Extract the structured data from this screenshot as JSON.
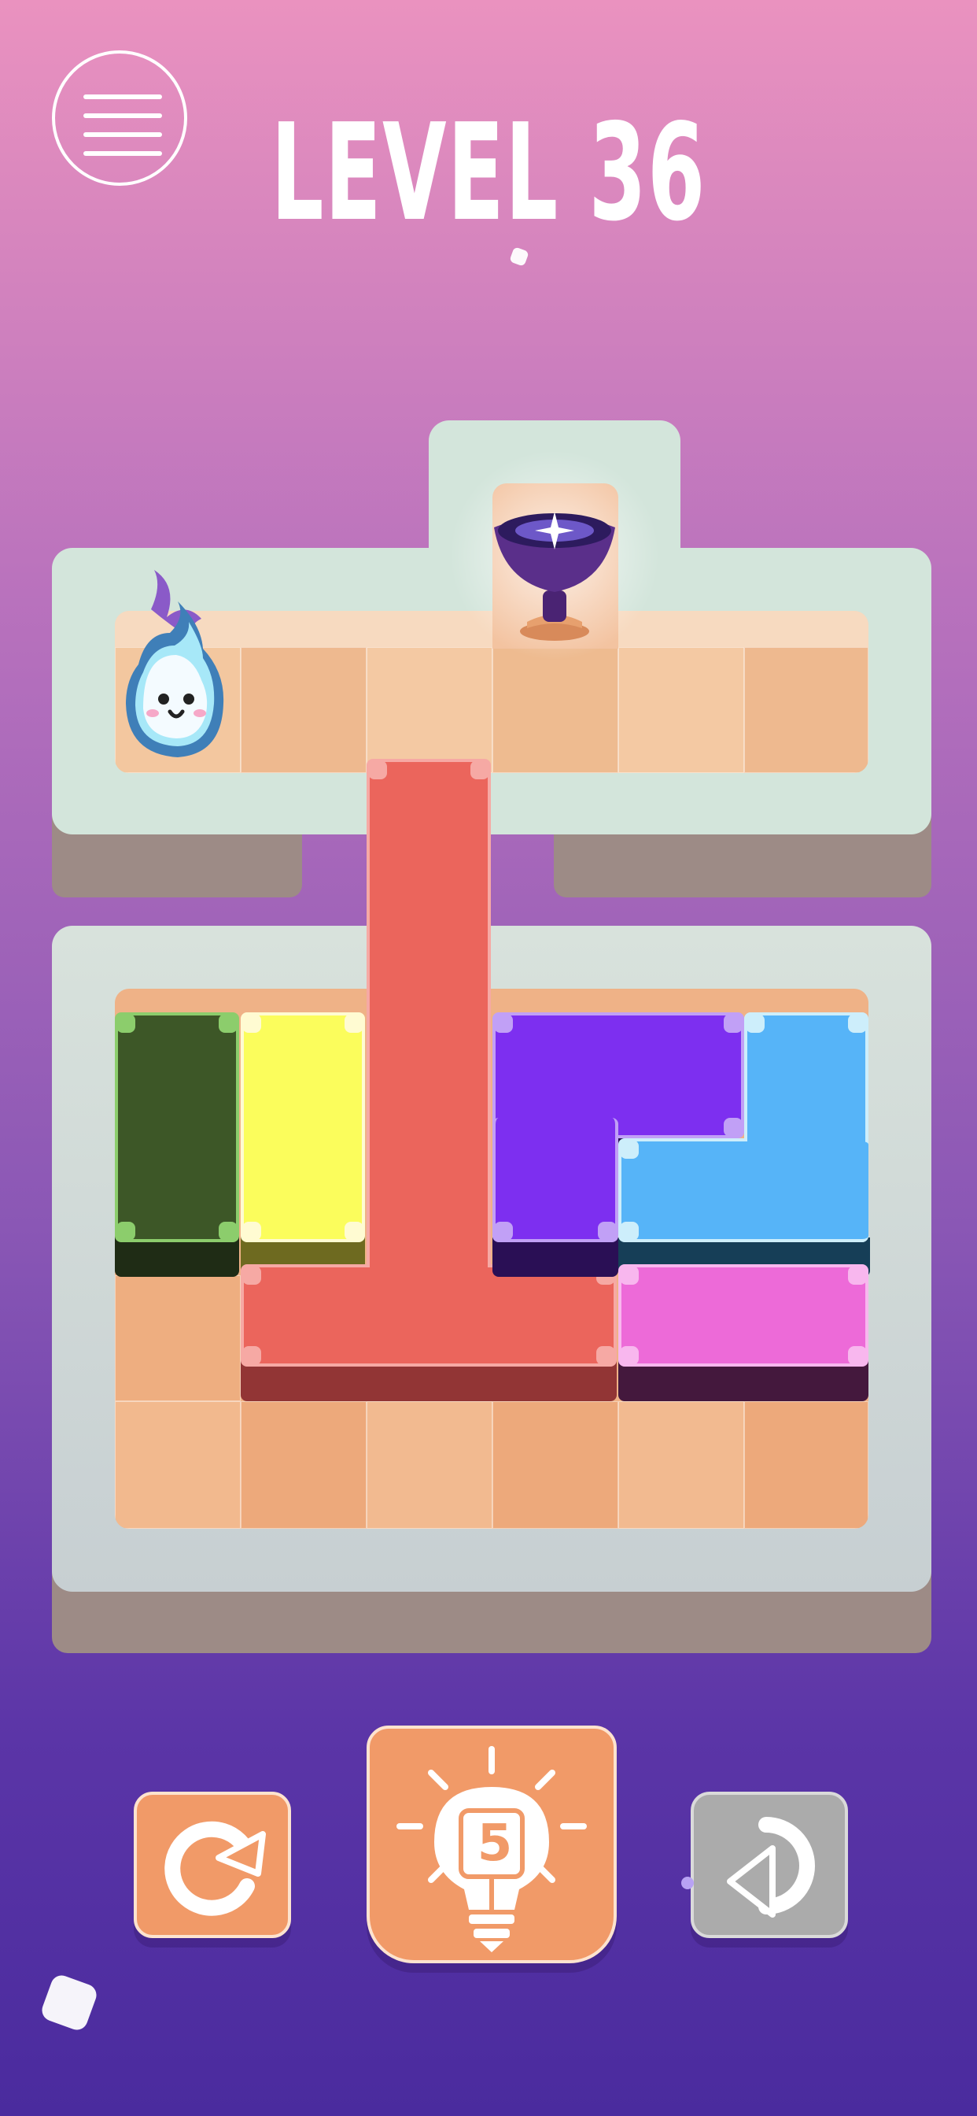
{
  "header": {
    "menu_icon": "hamburger-menu-icon",
    "level_title": "LEVEL 36"
  },
  "board": {
    "rows": 6,
    "cols": 6,
    "player": {
      "name": "fire-spirit",
      "color": "#9ee6f7",
      "flame_color": "#8a5ac8"
    },
    "goal": {
      "name": "purple-goblet",
      "color": "#5a2f8a"
    },
    "blocks": [
      {
        "name": "green-block",
        "color": "#3d5727"
      },
      {
        "name": "yellow-block",
        "color": "#fbfd5c"
      },
      {
        "name": "red-t-block",
        "color": "#eb655c"
      },
      {
        "name": "purple-block",
        "color": "#7d2ff0"
      },
      {
        "name": "blue-block",
        "color": "#56b4f8"
      },
      {
        "name": "pink-block",
        "color": "#ed6ad8"
      }
    ]
  },
  "controls": {
    "restart_icon": "restart-icon",
    "hint_icon": "lightbulb-hint-icon",
    "hint_count": "5",
    "undo_icon": "undo-icon"
  },
  "colors": {
    "accent": "#f19a68",
    "tile_light": "#f5c6a0",
    "tile_dark": "#eca97c",
    "disabled": "#ababab"
  }
}
